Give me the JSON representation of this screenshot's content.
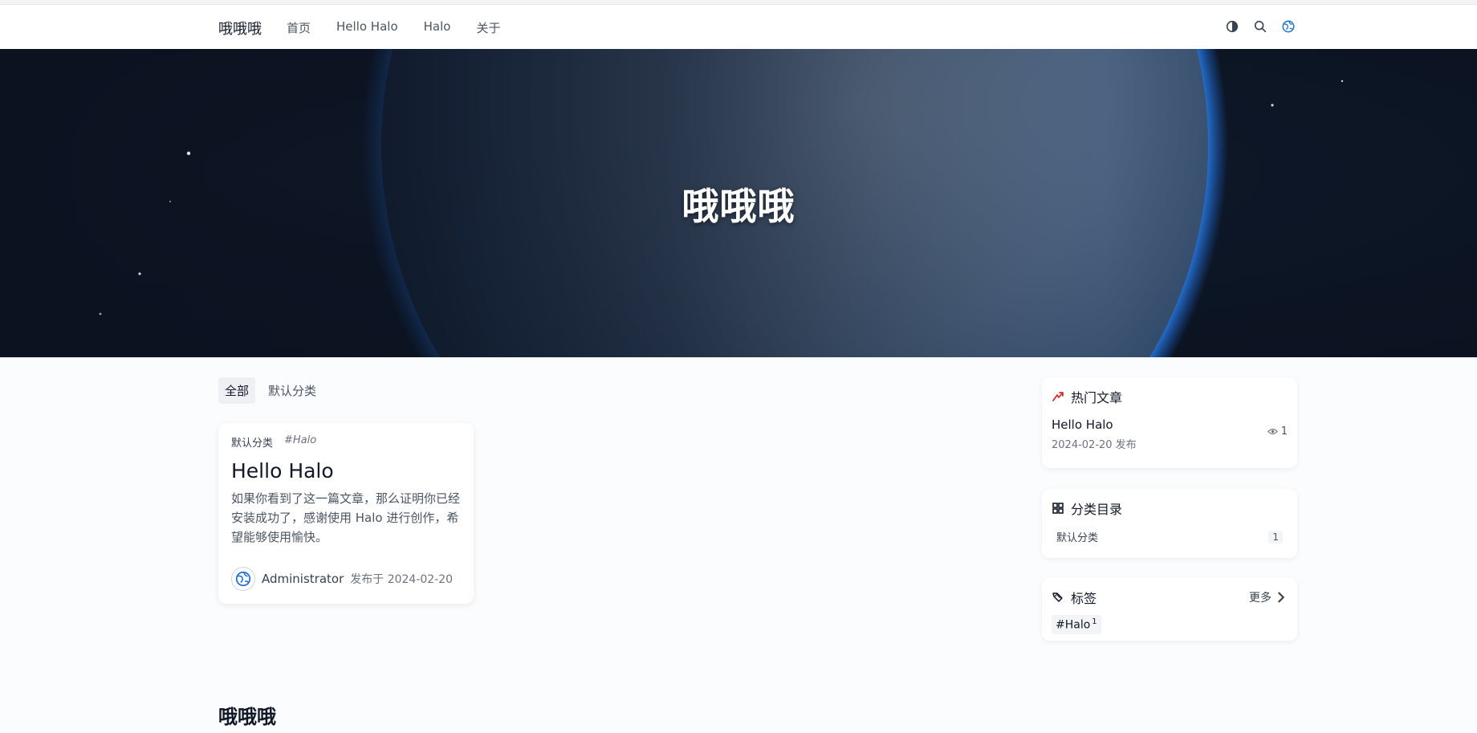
{
  "site": {
    "brand": "哦哦哦"
  },
  "nav": {
    "items": [
      "首页",
      "Hello Halo",
      "Halo",
      "关于"
    ]
  },
  "hero": {
    "title": "哦哦哦"
  },
  "tabs": [
    "全部",
    "默认分类"
  ],
  "post": {
    "category": "默认分类",
    "tag": "#Halo",
    "title": "Hello Halo",
    "excerpt": "如果你看到了这一篇文章，那么证明你已经安装成功了，感谢使用 Halo 进行创作，希望能够使用愉快。",
    "author": "Administrator",
    "date": "发布于 2024-02-20"
  },
  "widgets": {
    "hot": {
      "title": "热门文章",
      "item_title": "Hello Halo",
      "item_date": "2024-02-20 发布",
      "views": "1"
    },
    "categories": {
      "title": "分类目录",
      "items": [
        {
          "name": "默认分类",
          "count": "1"
        }
      ]
    },
    "tags": {
      "title": "标签",
      "more": "更多",
      "items": [
        {
          "name": "#Halo",
          "count": "1"
        }
      ]
    }
  },
  "footer": {
    "title": "哦哦哦"
  },
  "colors": {
    "hero_bg": "#0b1220",
    "accent_red": "#dc2626",
    "link_blue": "#1e6fd9"
  },
  "icons": [
    "theme-toggle-icon",
    "search-icon",
    "globe-icon",
    "trending-icon",
    "grid-icon",
    "tag-icon",
    "eye-icon",
    "chevron-right-icon"
  ]
}
